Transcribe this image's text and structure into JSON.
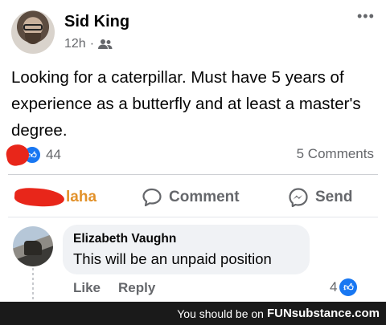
{
  "post": {
    "author": "Sid King",
    "time": "12h",
    "separator": "·",
    "text": "Looking for a caterpillar. Must have 5 years of experience as a butterfly and at least a master's degree.",
    "more_label": "•••"
  },
  "stats": {
    "reactions_count": "44",
    "comments_count": "5 Comments"
  },
  "actions": {
    "haha": "laha",
    "comment": "Comment",
    "send": "Send"
  },
  "comment": {
    "author": "Elizabeth Vaughn",
    "text": "This will be an unpaid position",
    "like_label": "Like",
    "reply_label": "Reply",
    "likes_count": "4"
  },
  "watermark": {
    "prefix": "You should be on",
    "brand": "FUNsubstance.com"
  },
  "colors": {
    "accent": "#1877f2",
    "redaction": "#e8261a",
    "haha": "#e2912a",
    "muted": "#65676b"
  }
}
